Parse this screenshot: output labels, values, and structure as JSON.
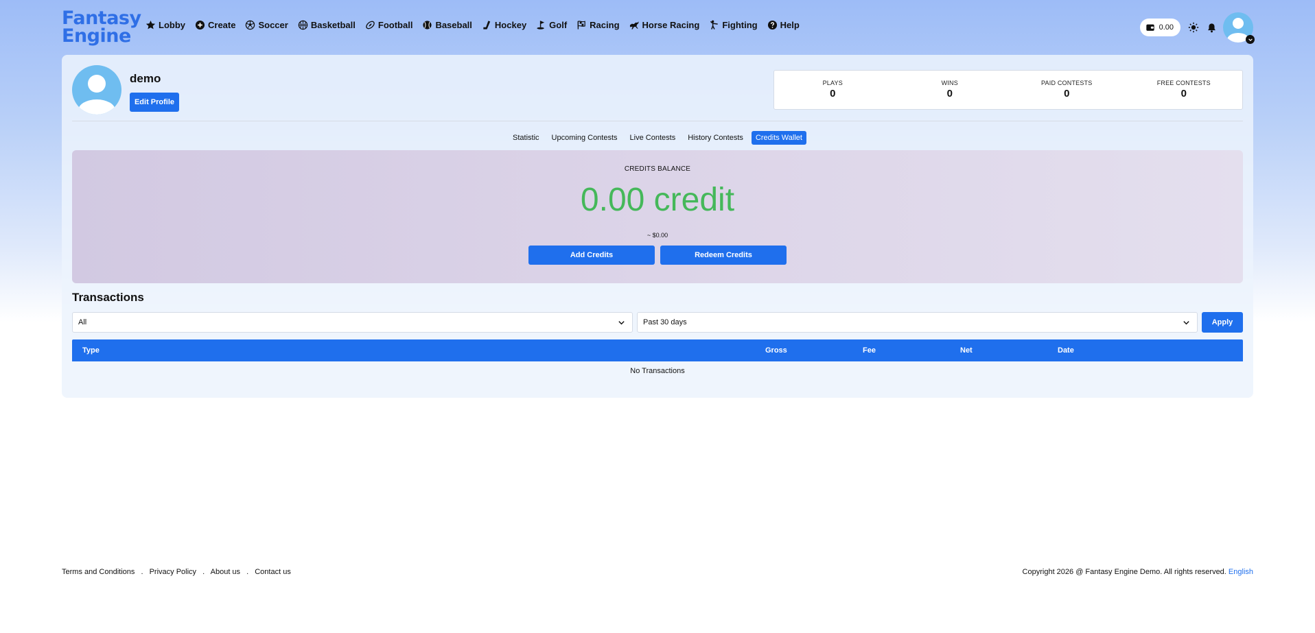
{
  "brand": {
    "line1": "Fantasy",
    "line2": "Engine"
  },
  "nav": [
    {
      "label": "Lobby",
      "icon": "star-icon"
    },
    {
      "label": "Create",
      "icon": "plus-circle-icon"
    },
    {
      "label": "Soccer",
      "icon": "soccer-ball-icon"
    },
    {
      "label": "Basketball",
      "icon": "basketball-icon"
    },
    {
      "label": "Football",
      "icon": "football-icon"
    },
    {
      "label": "Baseball",
      "icon": "baseball-icon"
    },
    {
      "label": "Hockey",
      "icon": "hockey-stick-icon"
    },
    {
      "label": "Golf",
      "icon": "golf-icon"
    },
    {
      "label": "Racing",
      "icon": "racing-flag-icon"
    },
    {
      "label": "Horse Racing",
      "icon": "horse-icon"
    },
    {
      "label": "Fighting",
      "icon": "fighter-icon"
    },
    {
      "label": "Help",
      "icon": "question-circle-icon"
    }
  ],
  "header": {
    "wallet_balance": "0.00"
  },
  "profile": {
    "username": "demo",
    "edit_label": "Edit Profile"
  },
  "stats": [
    {
      "label": "PLAYS",
      "value": "0"
    },
    {
      "label": "WINS",
      "value": "0"
    },
    {
      "label": "PAID CONTESTS",
      "value": "0"
    },
    {
      "label": "FREE CONTESTS",
      "value": "0"
    }
  ],
  "tabs": [
    {
      "label": "Statistic",
      "active": false
    },
    {
      "label": "Upcoming Contests",
      "active": false
    },
    {
      "label": "Live Contests",
      "active": false
    },
    {
      "label": "History Contests",
      "active": false
    },
    {
      "label": "Credits Wallet",
      "active": true
    }
  ],
  "wallet": {
    "balance_label": "CREDITS BALANCE",
    "amount": "0.00 credit",
    "usd": "~ $0.00",
    "add_label": "Add Credits",
    "redeem_label": "Redeem Credits",
    "amount_color": "#45b85a"
  },
  "transactions": {
    "title": "Transactions",
    "type_filter": "All",
    "period_filter": "Past 30 days",
    "apply_label": "Apply",
    "columns": [
      "Type",
      "Gross",
      "Fee",
      "Net",
      "Date"
    ],
    "empty_text": "No Transactions"
  },
  "footer": {
    "links": [
      "Terms and Conditions",
      "Privacy Policy",
      "About us",
      "Contact us"
    ],
    "separator": ".",
    "copyright": "Copyright 2026 @ Fantasy Engine Demo. All rights reserved.",
    "language": "English"
  },
  "colors": {
    "accent": "#1f6fed",
    "logo": "#2f6fe6"
  }
}
